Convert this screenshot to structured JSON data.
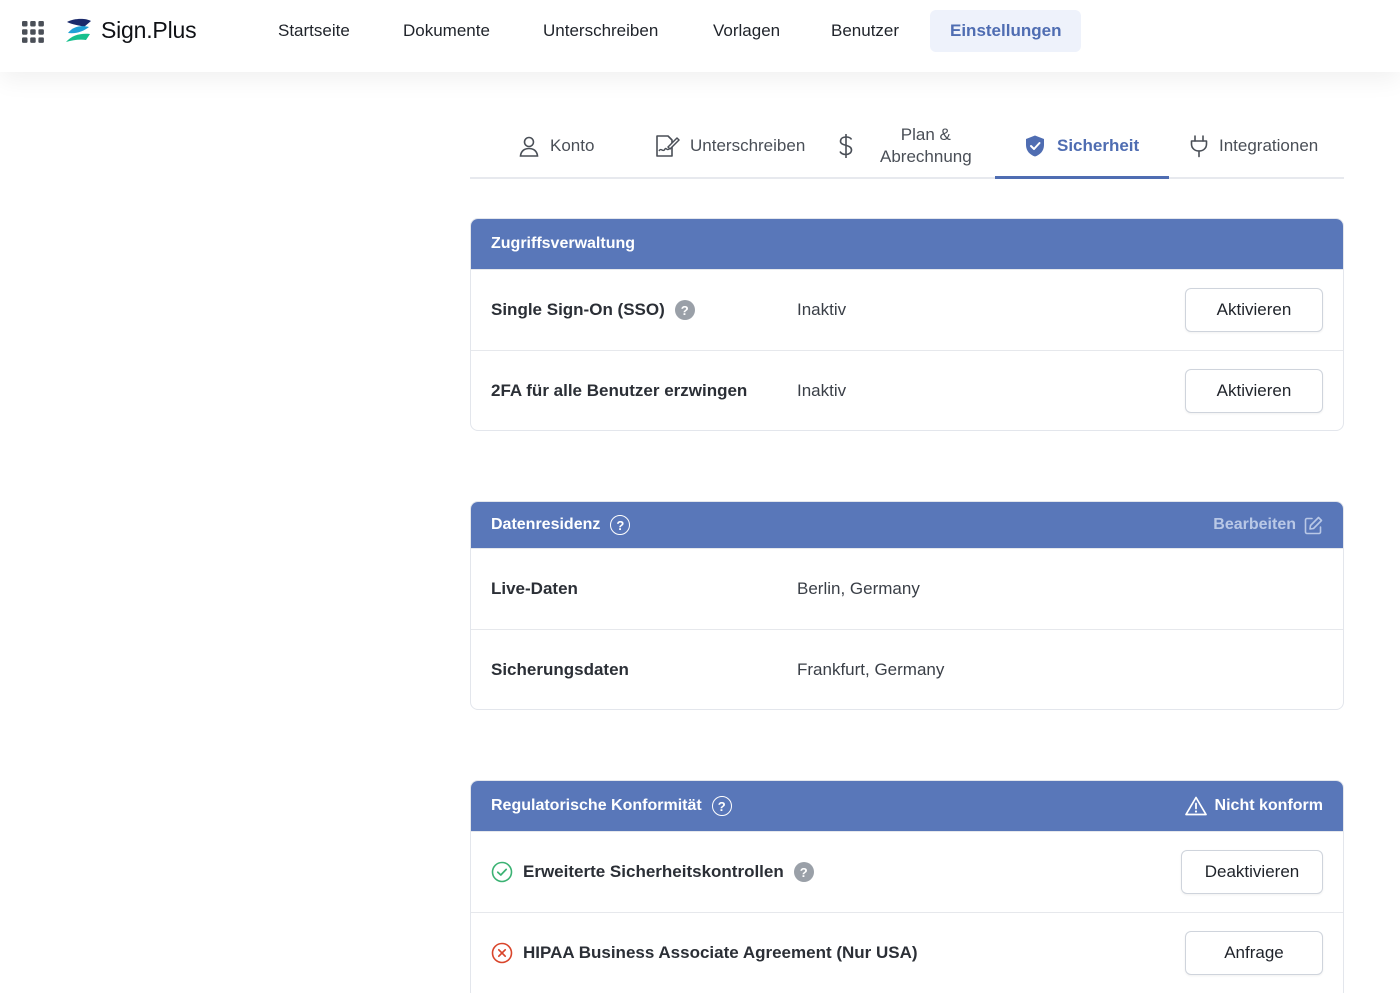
{
  "app": {
    "logo_text": "Sign.Plus"
  },
  "nav": {
    "items": [
      {
        "label": "Startseite"
      },
      {
        "label": "Dokumente"
      },
      {
        "label": "Unterschreiben"
      },
      {
        "label": "Vorlagen"
      },
      {
        "label": "Benutzer"
      },
      {
        "label": "Einstellungen",
        "active": true
      }
    ]
  },
  "tabs": {
    "items": [
      {
        "label": "Konto",
        "icon": "user-icon"
      },
      {
        "label": "Unterschreiben",
        "icon": "sign-document-icon"
      },
      {
        "label_line1": "Plan &",
        "label_line2": "Abrechnung",
        "icon": "dollar-icon"
      },
      {
        "label": "Sicherheit",
        "icon": "shield-check-icon",
        "active": true
      },
      {
        "label": "Integrationen",
        "icon": "plug-icon"
      }
    ]
  },
  "access": {
    "title": "Zugriffsverwaltung",
    "rows": [
      {
        "label": "Single Sign-On (SSO)",
        "value": "Inaktiv",
        "button": "Aktivieren",
        "help": "?"
      },
      {
        "label": "2FA für alle Benutzer erzwingen",
        "value": "Inaktiv",
        "button": "Aktivieren"
      }
    ]
  },
  "residency": {
    "title": "Datenresidenz",
    "help": "?",
    "edit_label": "Bearbeiten",
    "rows": [
      {
        "label": "Live-Daten",
        "value": "Berlin, Germany"
      },
      {
        "label": "Sicherungsdaten",
        "value": "Frankfurt, Germany"
      }
    ]
  },
  "compliance": {
    "title": "Regulatorische Konformität",
    "help": "?",
    "status_label": "Nicht konform",
    "rows": [
      {
        "label": "Erweiterte Sicherheitskontrollen",
        "status": "enabled",
        "button": "Deaktivieren",
        "help": "?"
      },
      {
        "label": "HIPAA Business Associate Agreement (Nur USA)",
        "status": "disabled",
        "button": "Anfrage"
      }
    ]
  },
  "colors": {
    "accent": "#4f6db2",
    "header_bg": "#5977b9",
    "success": "#3bb273",
    "danger": "#d9452b"
  }
}
